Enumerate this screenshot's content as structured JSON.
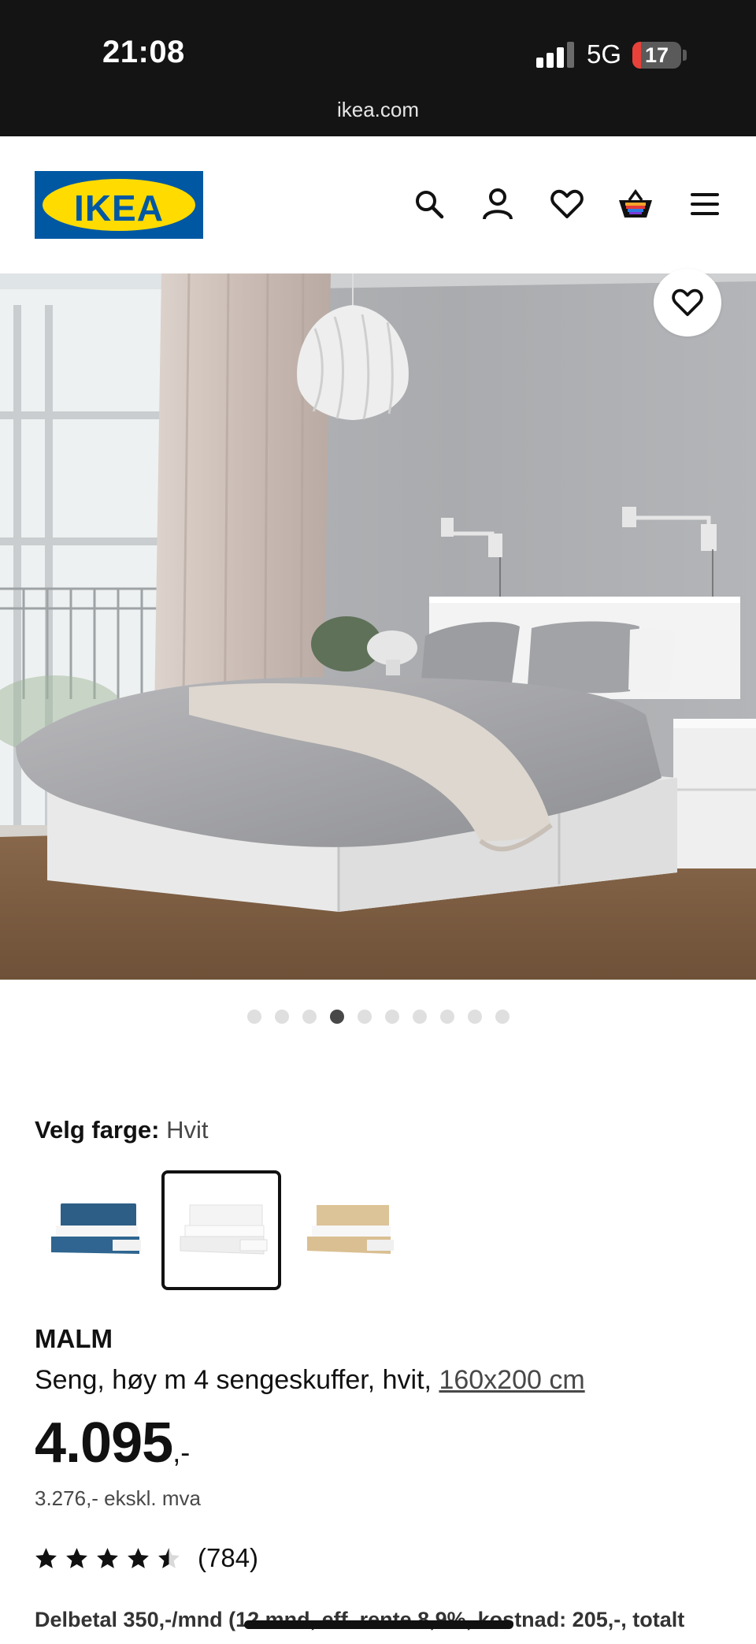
{
  "status_bar": {
    "time": "21:08",
    "network": "5G",
    "battery_level": "17",
    "battery_fraction": 0.17,
    "url": "ikea.com"
  },
  "header": {
    "logo_text": "IKEA",
    "icons": [
      "search-icon",
      "account-icon",
      "favorites-icon",
      "cart-icon",
      "menu-icon"
    ]
  },
  "product": {
    "image_count": 10,
    "active_image_index": 3,
    "color_label": "Velg farge:",
    "color_value": "Hvit",
    "swatches": [
      {
        "name": "blue",
        "color": "#2d5f86"
      },
      {
        "name": "white",
        "color": "#f4f4f4",
        "selected": true
      },
      {
        "name": "oak",
        "color": "#dcc398"
      }
    ],
    "name": "MALM",
    "description": "Seng, høy m 4 sengeskuffer, hvit,",
    "size": "160x200 cm",
    "price": "4.095",
    "price_suffix": ",-",
    "price_ex_vat": "3.276,- ekskl. mva",
    "rating": 4.5,
    "review_count": "(784)",
    "installment": "Delbetal 350,-/mnd (12 mnd, eff. rente 8,9%, kostnad: 205,-, totalt"
  },
  "colors": {
    "statusbar_bg": "#141414",
    "ikea_blue": "#0058a3",
    "ikea_yellow": "#ffdb00",
    "battery_red": "#e8413a"
  }
}
